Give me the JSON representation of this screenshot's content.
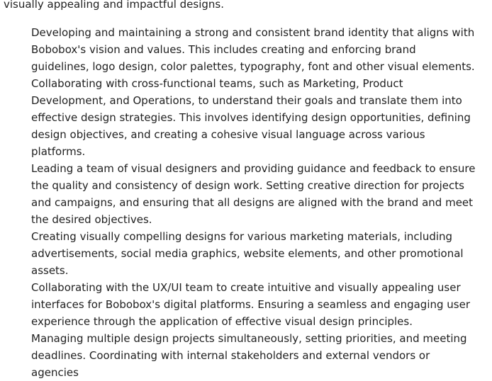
{
  "document": {
    "intro_tail": "visually appealing and impactful designs.",
    "responsibilities": [
      "Developing and maintaining a strong and consistent brand identity that aligns with Bobobox's vision and values. This includes creating and enforcing brand guidelines, logo design, color palettes, typography, font and other visual elements.",
      "Collaborating with cross-functional teams, such as Marketing, Product Development, and Operations, to understand their goals and translate them into effective design strategies. This involves identifying design opportunities, defining design objectives, and creating a cohesive visual language across various platforms.",
      "Leading a team of visual designers and providing guidance and feedback to ensure the quality and consistency of design work. Setting creative direction for projects and campaigns, and ensuring that all designs are aligned with the brand and meet the desired objectives.",
      "Creating visually compelling designs for various marketing materials, including advertisements, social media graphics, website elements, and other promotional assets.",
      "Collaborating with the UX/UI team to create intuitive and visually appealing user interfaces for Bobobox's digital platforms. Ensuring a seamless and engaging user experience through the application of effective visual design principles.",
      "Managing multiple design projects simultaneously, setting priorities, and meeting deadlines. Coordinating with internal stakeholders and external vendors or agencies"
    ]
  }
}
